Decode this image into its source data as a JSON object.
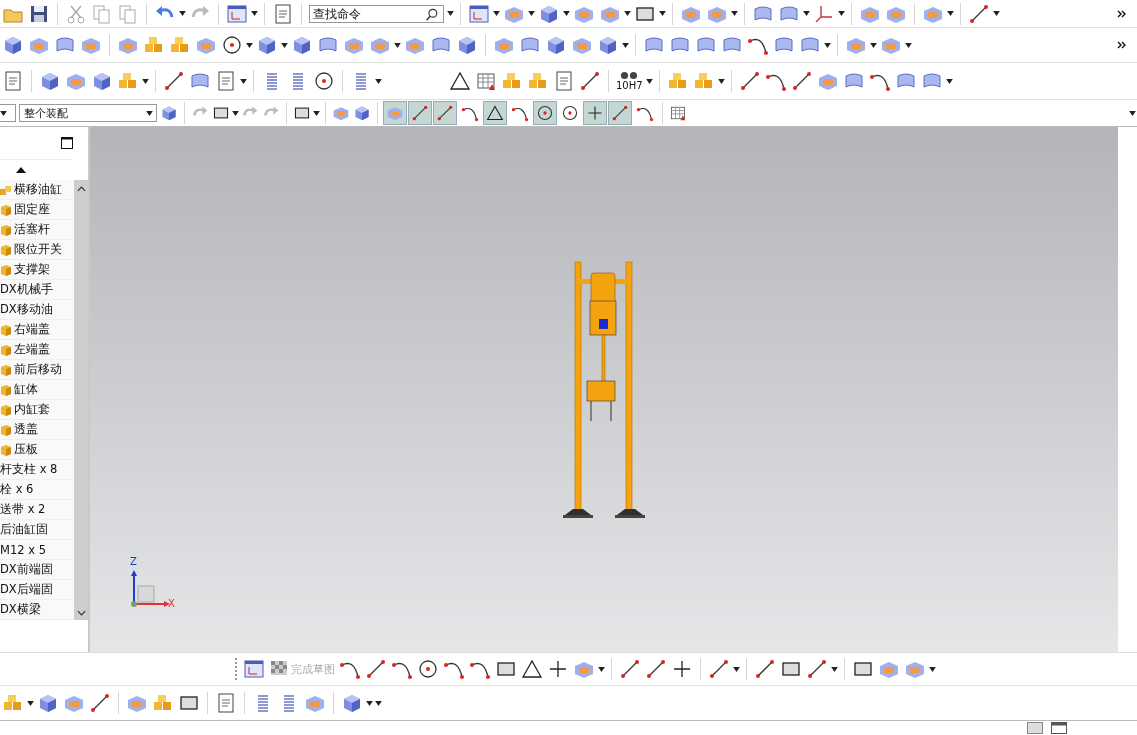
{
  "toolbar": {
    "search": {
      "placeholder": "查找命令"
    },
    "tolerance_label": "10H7"
  },
  "selection_bar": {
    "scope": "整个装配",
    "snap_buttons": [
      {
        "selected": true
      },
      {
        "selected": true
      },
      {
        "selected": true
      },
      {
        "selected": false
      },
      {
        "selected": true
      },
      {
        "selected": false
      },
      {
        "selected": true
      },
      {
        "selected": false
      },
      {
        "selected": true
      },
      {
        "selected": true
      },
      {
        "selected": false
      }
    ]
  },
  "assembly_navigator": {
    "items": [
      {
        "label": "横移油缸",
        "kind": "assembly"
      },
      {
        "label": "固定座",
        "kind": "part"
      },
      {
        "label": "活塞杆",
        "kind": "part"
      },
      {
        "label": "限位开关",
        "kind": "part"
      },
      {
        "label": "支撑架",
        "kind": "part"
      },
      {
        "label": "DX机械手",
        "kind": "plain"
      },
      {
        "label": "DX移动油",
        "kind": "plain"
      },
      {
        "label": "右端盖",
        "kind": "part"
      },
      {
        "label": "左端盖",
        "kind": "part"
      },
      {
        "label": "前后移动",
        "kind": "part"
      },
      {
        "label": "缸体",
        "kind": "part"
      },
      {
        "label": "内缸套",
        "kind": "part"
      },
      {
        "label": "透盖",
        "kind": "part"
      },
      {
        "label": "压板",
        "kind": "part"
      },
      {
        "label": "杆支柱 x 8",
        "kind": "plain"
      },
      {
        "label": "栓 x 6",
        "kind": "plain"
      },
      {
        "label": "送带 x 2",
        "kind": "plain"
      },
      {
        "label": "后油缸固",
        "kind": "plain"
      },
      {
        "label": "M12 x 5",
        "kind": "plain"
      },
      {
        "label": "DX前端固",
        "kind": "plain"
      },
      {
        "label": "DX后端固",
        "kind": "plain"
      },
      {
        "label": "DX横梁",
        "kind": "plain"
      }
    ]
  },
  "viewport": {
    "axis_labels": {
      "z": "Z",
      "x": "X"
    }
  },
  "sketch_toolbar": {
    "finish_sketch": {
      "label": "完成草图",
      "disabled": true
    }
  }
}
